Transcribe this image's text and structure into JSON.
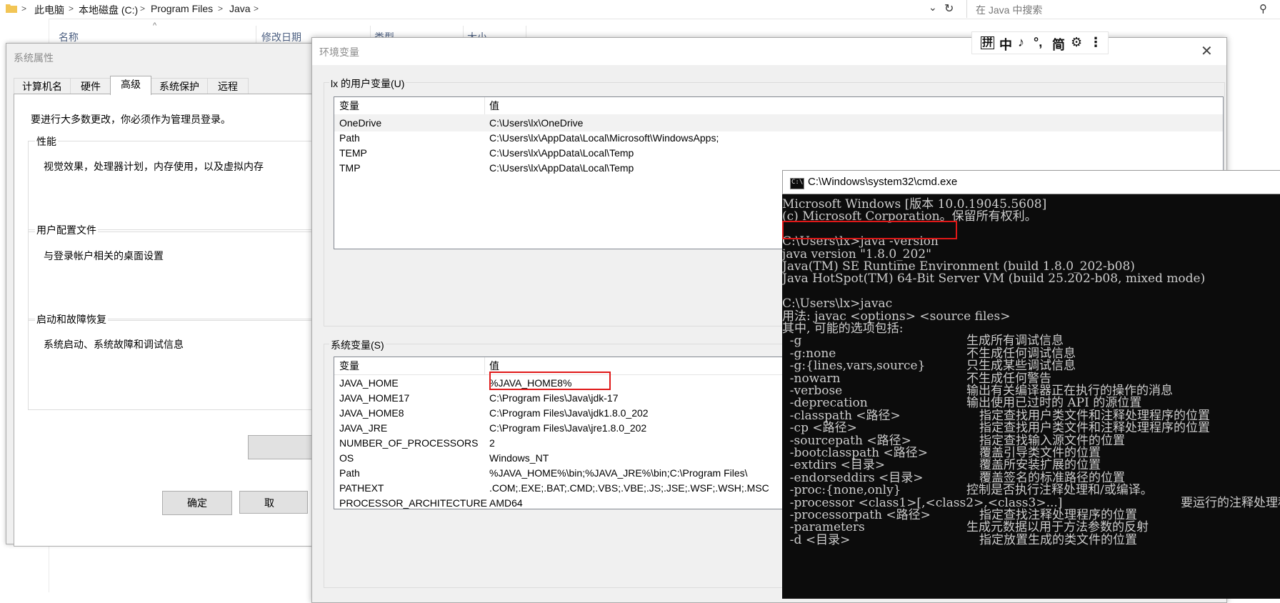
{
  "explorer": {
    "breadcrumb": [
      "此电脑",
      "本地磁盘 (C:)",
      "Program Files",
      "Java"
    ],
    "search_placeholder": "在 Java 中搜索",
    "columns": [
      "名称",
      "修改日期",
      "类型",
      "大小"
    ]
  },
  "system_properties": {
    "title": "系统属性",
    "tabs": [
      "计算机名",
      "硬件",
      "高级",
      "系统保护",
      "远程"
    ],
    "active_tab": "高级",
    "admin_note": "要进行大多数更改，你必须作为管理员登录。",
    "groups": [
      {
        "title": "性能",
        "desc": "视觉效果，处理器计划，内存使用，以及虚拟内存"
      },
      {
        "title": "用户配置文件",
        "desc": "与登录帐户相关的桌面设置"
      },
      {
        "title": "启动和故障恢复",
        "desc": "系统启动、系统故障和调试信息"
      }
    ],
    "ok_label": "确定",
    "cancel_label": "取"
  },
  "env_vars": {
    "title": "环境变量",
    "user_section_label": "lx 的用户变量(U)",
    "system_section_label": "系统变量(S)",
    "col_name": "变量",
    "col_value": "值",
    "user_vars": [
      {
        "name": "OneDrive",
        "value": "C:\\Users\\lx\\OneDrive"
      },
      {
        "name": "Path",
        "value": "C:\\Users\\lx\\AppData\\Local\\Microsoft\\WindowsApps;"
      },
      {
        "name": "TEMP",
        "value": "C:\\Users\\lx\\AppData\\Local\\Temp"
      },
      {
        "name": "TMP",
        "value": "C:\\Users\\lx\\AppData\\Local\\Temp"
      }
    ],
    "system_vars": [
      {
        "name": "JAVA_HOME",
        "value": "%JAVA_HOME8%"
      },
      {
        "name": "JAVA_HOME17",
        "value": "C:\\Program Files\\Java\\jdk-17"
      },
      {
        "name": "JAVA_HOME8",
        "value": "C:\\Program Files\\Java\\jdk1.8.0_202"
      },
      {
        "name": "JAVA_JRE",
        "value": "C:\\Program Files\\Java\\jre1.8.0_202"
      },
      {
        "name": "NUMBER_OF_PROCESSORS",
        "value": "2"
      },
      {
        "name": "OS",
        "value": "Windows_NT"
      },
      {
        "name": "Path",
        "value": "%JAVA_HOME%\\bin;%JAVA_JRE%\\bin;C:\\Program Files\\"
      },
      {
        "name": "PATHEXT",
        "value": ".COM;.EXE;.BAT;.CMD;.VBS;.VBE;.JS;.JSE;.WSF;.WSH;.MSC"
      },
      {
        "name": "PROCESSOR_ARCHITECTURE",
        "value": "AMD64"
      }
    ]
  },
  "ime": {
    "buttons": [
      "拼",
      "中",
      "♪",
      "°,",
      "简",
      "⚙",
      "⋮"
    ]
  },
  "cmd": {
    "title": "C:\\Windows\\system32\\cmd.exe",
    "lines": [
      "Microsoft Windows [版本 10.0.19045.5608]",
      "(c) Microsoft Corporation。保留所有权利。",
      "",
      "C:\\Users\\lx>java -version",
      "java version \"1.8.0_202\"",
      "Java(TM) SE Runtime Environment (build 1.8.0_202-b08)",
      "Java HotSpot(TM) 64-Bit Server VM (build 25.202-b08, mixed mode)",
      "",
      "C:\\Users\\lx>javac",
      "用法: javac <options> <source files>",
      "其中, 可能的选项包括:"
    ],
    "options": [
      {
        "opt": "  -g",
        "desc": "生成所有调试信息",
        "indent": false
      },
      {
        "opt": "  -g:none",
        "desc": "不生成任何调试信息",
        "indent": false
      },
      {
        "opt": "  -g:{lines,vars,source}",
        "desc": "只生成某些调试信息",
        "indent": false
      },
      {
        "opt": "  -nowarn",
        "desc": "不生成任何警告",
        "indent": false
      },
      {
        "opt": "  -verbose",
        "desc": "输出有关编译器正在执行的操作的消息",
        "indent": false
      },
      {
        "opt": "  -deprecation",
        "desc": "输出使用已过时的 API 的源位置",
        "indent": false
      },
      {
        "opt": "  -classpath <路径>",
        "desc": "指定查找用户类文件和注释处理程序的位置",
        "indent": true
      },
      {
        "opt": "  -cp <路径>",
        "desc": "指定查找用户类文件和注释处理程序的位置",
        "indent": true
      },
      {
        "opt": "  -sourcepath <路径>",
        "desc": "指定查找输入源文件的位置",
        "indent": true
      },
      {
        "opt": "  -bootclasspath <路径>",
        "desc": "覆盖引导类文件的位置",
        "indent": true
      },
      {
        "opt": "  -extdirs <目录>",
        "desc": "覆盖所安装扩展的位置",
        "indent": true
      },
      {
        "opt": "  -endorseddirs <目录>",
        "desc": "覆盖签名的标准路径的位置",
        "indent": true
      },
      {
        "opt": "  -proc:{none,only}",
        "desc": "控制是否执行注释处理和/或编译。",
        "indent": false
      },
      {
        "opt": "  -processor <class1>[,<class2>,<class3>...]",
        "desc": "要运行的注释处理程序的名称",
        "indent": null
      },
      {
        "opt": "  -processorpath <路径>",
        "desc": "指定查找注释处理程序的位置",
        "indent": true
      },
      {
        "opt": "  -parameters",
        "desc": "生成元数据以用于方法参数的反射",
        "indent": false
      },
      {
        "opt": "  -d <目录>",
        "desc": "指定放置生成的类文件的位置",
        "indent": true
      }
    ]
  },
  "colors": {
    "highlight": "#e01818",
    "cmd_bg": "#0c0c0c",
    "cmd_text": "#cccccc"
  }
}
